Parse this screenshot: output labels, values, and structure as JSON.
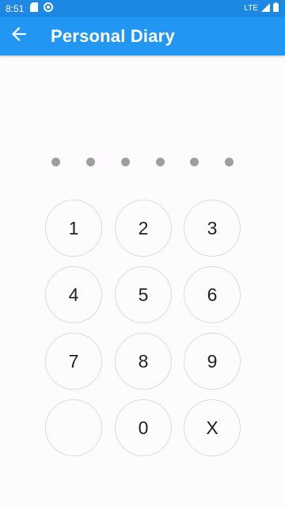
{
  "status_bar": {
    "time": "8:51",
    "network": "LTE",
    "icons": [
      "sd-card-icon",
      "sync-icon",
      "signal-icon",
      "battery-icon"
    ]
  },
  "app_bar": {
    "title": "Personal Diary",
    "back_icon": "arrow-back-icon",
    "color": "#2196f3"
  },
  "pin": {
    "length": 6,
    "entered": 0,
    "dot_color": "#9e9e9e"
  },
  "keypad": {
    "keys": [
      "1",
      "2",
      "3",
      "4",
      "5",
      "6",
      "7",
      "8",
      "9",
      "",
      "0",
      "X"
    ]
  }
}
